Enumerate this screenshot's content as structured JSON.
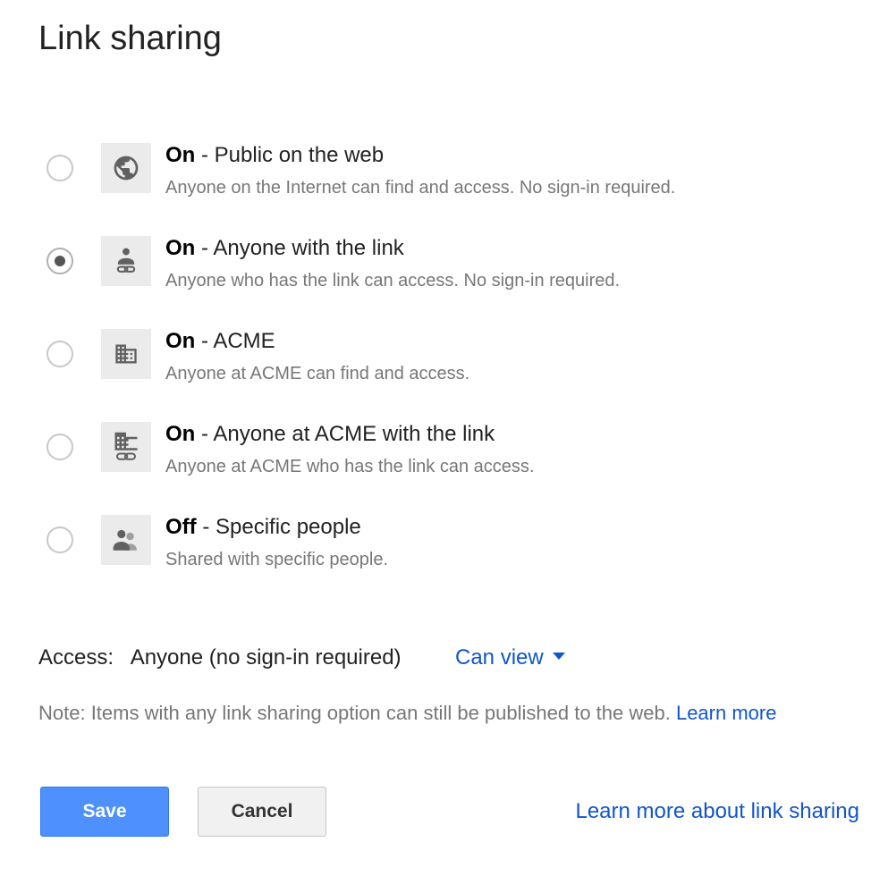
{
  "dialog": {
    "title": "Link sharing"
  },
  "options": [
    {
      "state": "On",
      "label": " - Public on the web",
      "description": "Anyone on the Internet can find and access. No sign-in required.",
      "icon": "globe-icon",
      "selected": false
    },
    {
      "state": "On",
      "label": " - Anyone with the link",
      "description": "Anyone who has the link can access. No sign-in required.",
      "icon": "person-link-icon",
      "selected": true
    },
    {
      "state": "On",
      "label": " - ACME",
      "description": "Anyone at ACME can find and access.",
      "icon": "building-icon",
      "selected": false
    },
    {
      "state": "On",
      "label": " - Anyone at ACME with the link",
      "description": "Anyone at ACME who has the link can access.",
      "icon": "building-link-icon",
      "selected": false
    },
    {
      "state": "Off",
      "label": " - Specific people",
      "description": "Shared with specific people.",
      "icon": "people-icon",
      "selected": false
    }
  ],
  "access": {
    "label": "Access:",
    "value": "Anyone (no sign-in required)",
    "permission": "Can view"
  },
  "note": {
    "text": "Note: Items with any link sharing option can still be published to the web. ",
    "link": "Learn more"
  },
  "buttons": {
    "save": "Save",
    "cancel": "Cancel"
  },
  "help_link": "Learn more about link sharing",
  "colors": {
    "link": "#1155cc",
    "primary_button": "#4d90fe",
    "secondary_text": "#777777"
  }
}
